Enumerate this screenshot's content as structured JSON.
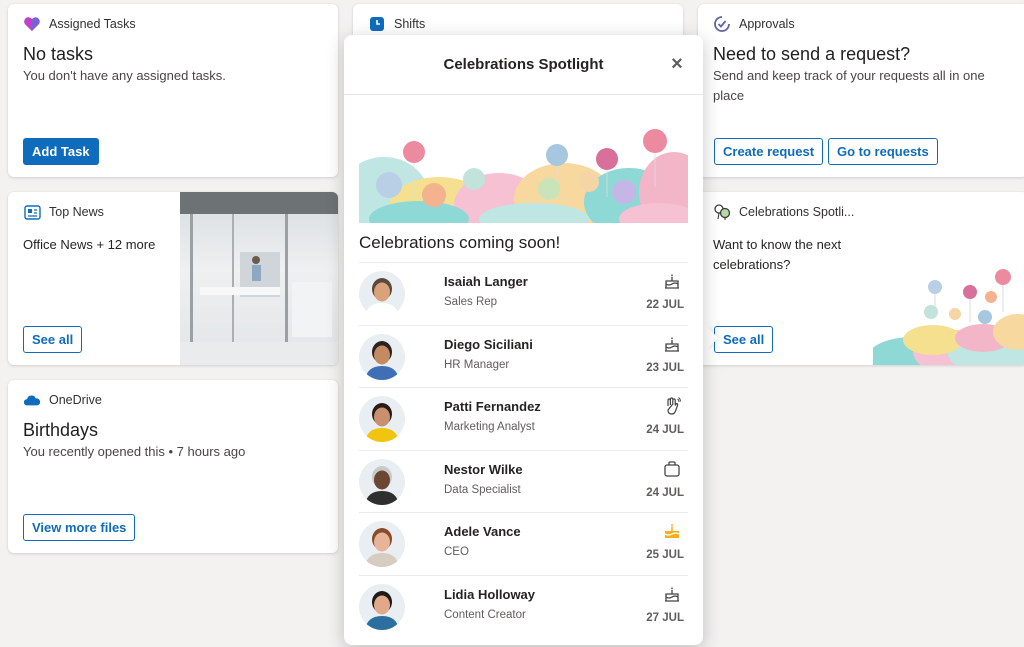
{
  "assigned": {
    "header": "Assigned Tasks",
    "title": "No tasks",
    "subtitle": "You don't have any assigned tasks.",
    "button": "Add Task"
  },
  "shifts": {
    "header": "Shifts"
  },
  "approvals": {
    "header": "Approvals",
    "title": "Need to send a request?",
    "subtitle": "Send and keep track of your requests all in one place",
    "create_button": "Create request",
    "go_button": "Go to requests"
  },
  "topnews": {
    "header": "Top News",
    "text": "Office News + 12 more",
    "button": "See all"
  },
  "celebrations_card": {
    "header": "Celebrations Spotli...",
    "text": "Want to know the next celebrations?",
    "button": "See all"
  },
  "onedrive": {
    "header": "OneDrive",
    "title": "Birthdays",
    "subtitle": "You recently opened this • 7 hours ago",
    "button": "View more files"
  },
  "popup": {
    "title": "Celebrations Spotlight",
    "subtitle": "Celebrations coming soon!",
    "people": [
      {
        "name": "Isaiah Langer",
        "role": "Sales Rep",
        "date": "22 JUL",
        "icon": "cake-icon",
        "skin": "#d9a27a",
        "hair": "#5a4a3a",
        "shirt": "#ffffff"
      },
      {
        "name": "Diego Siciliani",
        "role": "HR Manager",
        "date": "23 JUL",
        "icon": "cake-icon",
        "skin": "#c58a62",
        "hair": "#2b2320",
        "shirt": "#3f6fb5"
      },
      {
        "name": "Patti Fernandez",
        "role": "Marketing Analyst",
        "date": "24 JUL",
        "icon": "wave-icon",
        "skin": "#c99070",
        "hair": "#2a1d17",
        "shirt": "#f1c40f"
      },
      {
        "name": "Nestor Wilke",
        "role": "Data Specialist",
        "date": "24 JUL",
        "icon": "briefcase-icon",
        "skin": "#6b4631",
        "hair": "#c9c9c9",
        "shirt": "#2f2f2f"
      },
      {
        "name": "Adele Vance",
        "role": "CEO",
        "date": "25 JUL",
        "icon": "cake-filled-icon",
        "skin": "#e8b497",
        "hair": "#8a4b2a",
        "shirt": "#d7ccc0"
      },
      {
        "name": "Lidia Holloway",
        "role": "Content Creator",
        "date": "27 JUL",
        "icon": "cake-icon",
        "skin": "#e1a98a",
        "hair": "#1f1a17",
        "shirt": "#2b6f9e"
      }
    ]
  },
  "colors": {
    "accent": "#0f6cbd",
    "background": "#f3f2f1"
  }
}
